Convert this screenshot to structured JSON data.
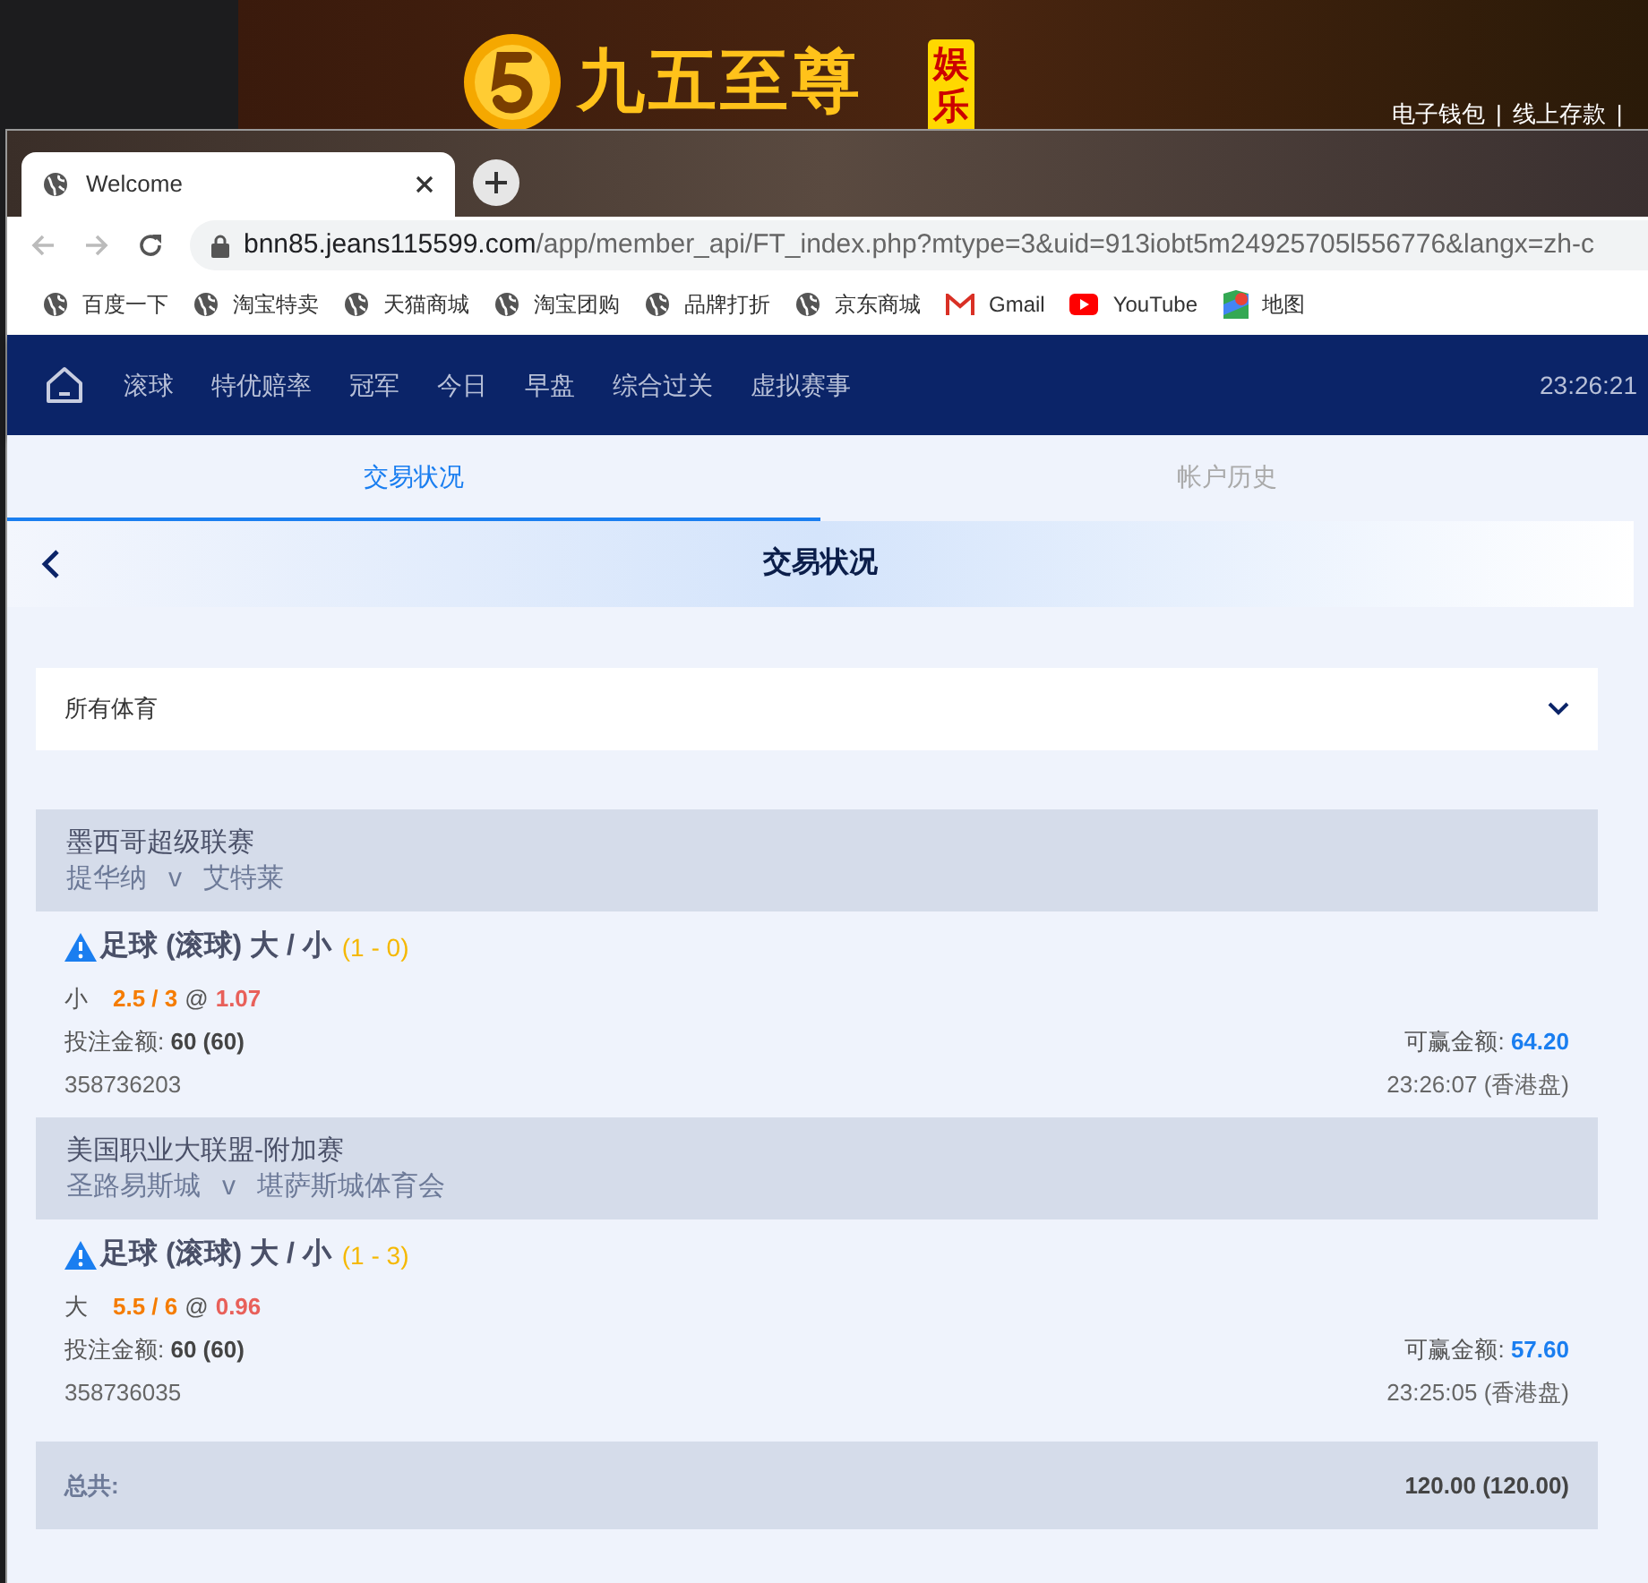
{
  "banner": {
    "logo_text": "九五至尊",
    "badge": "娱乐",
    "links": [
      "电子钱包",
      "线上存款"
    ],
    "separator": "|"
  },
  "browser": {
    "tab": {
      "title": "Welcome"
    },
    "url": {
      "host": "bnn85.jeans115599.com",
      "path": "/app/member_api/FT_index.php?mtype=3&uid=913iobt5m24925705l556776&langx=zh-c"
    },
    "bookmarks": [
      {
        "label": "百度一下",
        "kind": "globe"
      },
      {
        "label": "淘宝特卖",
        "kind": "globe"
      },
      {
        "label": "天猫商城",
        "kind": "globe"
      },
      {
        "label": "淘宝团购",
        "kind": "globe"
      },
      {
        "label": "品牌打折",
        "kind": "globe"
      },
      {
        "label": "京东商城",
        "kind": "globe"
      },
      {
        "label": "Gmail",
        "kind": "gmail"
      },
      {
        "label": "YouTube",
        "kind": "youtube"
      },
      {
        "label": "地图",
        "kind": "maps"
      }
    ]
  },
  "nav": {
    "items": [
      "滚球",
      "特优赔率",
      "冠军",
      "今日",
      "早盘",
      "综合过关",
      "虚拟赛事"
    ],
    "time": "23:26:21"
  },
  "tabs": [
    {
      "label": "交易状况",
      "selected": true
    },
    {
      "label": "帐户历史",
      "selected": false
    }
  ],
  "header": {
    "title": "交易状况"
  },
  "filter": {
    "value": "所有体育"
  },
  "bets": [
    {
      "league": "墨西哥超级联赛",
      "home": "提华纳",
      "vs": "v",
      "away": "艾特莱",
      "market": "足球 (滚球) 大 / 小",
      "score": "(1 - 0)",
      "side": "小",
      "line": "2.5 / 3",
      "at": "@",
      "odds": "1.07",
      "stake_label": "投注金额:",
      "stake": "60 (60)",
      "win_label": "可赢金额:",
      "win": "64.20",
      "ticket": "358736203",
      "time": "23:26:07 (香港盘)"
    },
    {
      "league": "美国职业大联盟-附加赛",
      "home": "圣路易斯城",
      "vs": "v",
      "away": "堪萨斯城体育会",
      "market": "足球 (滚球) 大 / 小",
      "score": "(1 - 3)",
      "side": "大",
      "line": "5.5 / 6",
      "at": "@",
      "odds": "0.96",
      "stake_label": "投注金额:",
      "stake": "60 (60)",
      "win_label": "可赢金额:",
      "win": "57.60",
      "ticket": "358736035",
      "time": "23:25:05 (香港盘)"
    }
  ],
  "total": {
    "label": "总共:",
    "value": "120.00 (120.00)"
  }
}
